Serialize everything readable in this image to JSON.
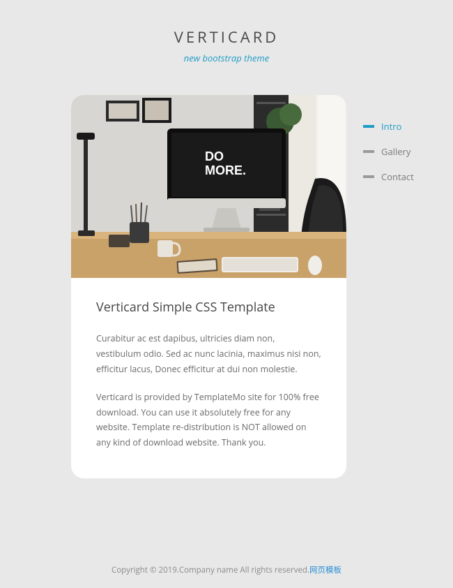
{
  "header": {
    "title": "VERTICARD",
    "subtitle": "new bootstrap theme"
  },
  "nav": {
    "items": [
      {
        "label": "Intro",
        "active": true
      },
      {
        "label": "Gallery",
        "active": false
      },
      {
        "label": "Contact",
        "active": false
      }
    ]
  },
  "card": {
    "image_alt": "Desk workspace with iMac displaying DO MORE",
    "monitor_text_1": "DO",
    "monitor_text_2": "MORE.",
    "heading": "Verticard Simple CSS Template",
    "paragraphs": [
      "Curabitur ac est dapibus, ultricies diam non, vestibulum odio. Sed ac nunc lacinia, maximus nisi non, efficitur lacus, Donec efficitur at dui non molestie.",
      "Verticard is provided by TemplateMo site for 100% free download. You can use it absolutely free for any website. Template re-distribution is NOT allowed on any kind of download website. Thank you."
    ]
  },
  "footer": {
    "copyright": "Copyright © 2019.Company name All rights reserved.",
    "link_text": "网页模板"
  }
}
